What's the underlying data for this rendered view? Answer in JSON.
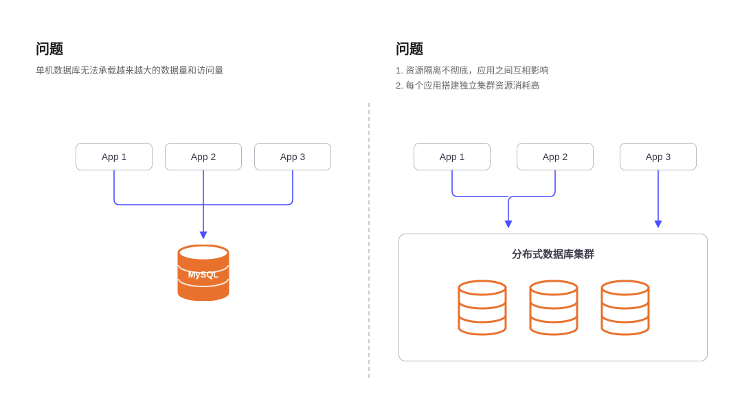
{
  "left": {
    "heading": "问题",
    "desc": "单机数据库无法承载越来越大的数据量和访问量",
    "apps": [
      "App 1",
      "App 2",
      "App 3"
    ],
    "db_label": "MySQL"
  },
  "right": {
    "heading": "问题",
    "desc_line1": "1. 资源隔离不彻底，应用之间互相影响",
    "desc_line2": "2. 每个应用搭建独立集群资源消耗高",
    "apps": [
      "App 1",
      "App 2",
      "App 3"
    ],
    "cluster_title": "分布式数据库集群"
  },
  "colors": {
    "arrow": "#4a4fff",
    "db": "#e8722d",
    "text_dark": "#1a1a1a",
    "text_mid": "#666666",
    "box_border": "#b5b7c4"
  }
}
